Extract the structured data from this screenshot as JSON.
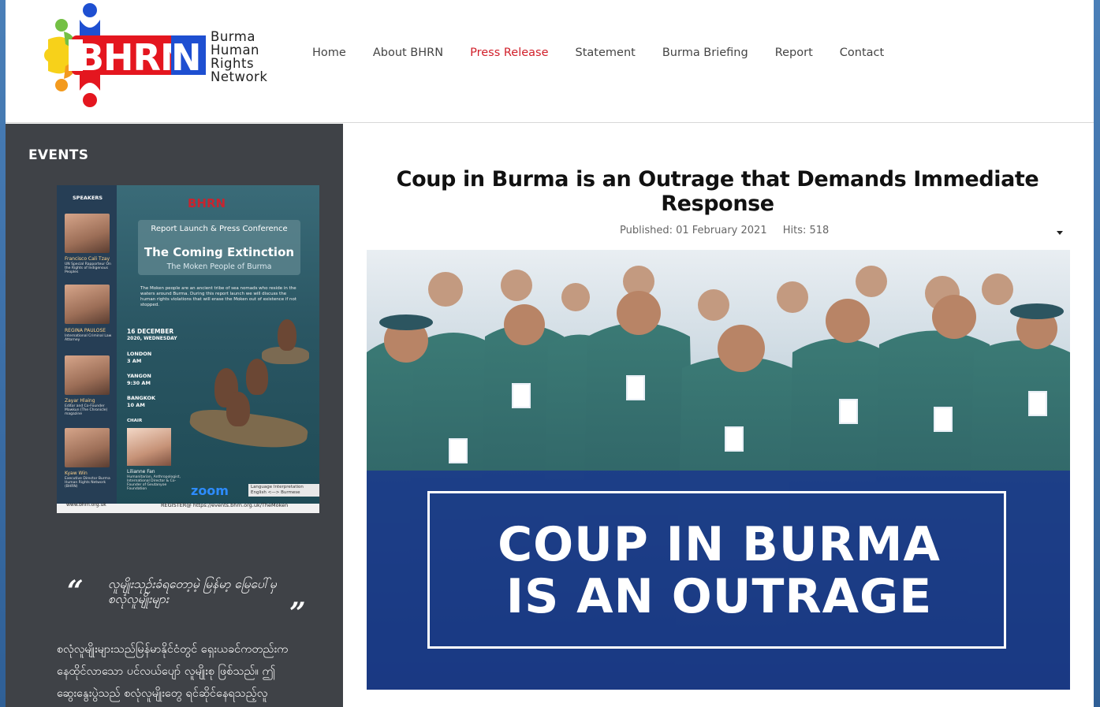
{
  "site": {
    "logo_letters": "BHRN",
    "logo_lines": [
      "Burma",
      "Human",
      "Rights",
      "Network"
    ]
  },
  "nav": {
    "items": [
      {
        "label": "Home",
        "active": false
      },
      {
        "label": "About BHRN",
        "active": false
      },
      {
        "label": "Press Release",
        "active": true
      },
      {
        "label": "Statement",
        "active": false
      },
      {
        "label": "Burma Briefing",
        "active": false
      },
      {
        "label": "Report",
        "active": false
      },
      {
        "label": "Contact",
        "active": false
      }
    ],
    "active_color": "#d11f2a"
  },
  "sidebar": {
    "title": "EVENTS",
    "poster": {
      "speakers_label": "SPEAKERS",
      "logo": "BHRN",
      "report_line": "Report Launch & Press Conference",
      "headline": "The Coming Extinction",
      "subheadline": "The Moken People of Burma",
      "description": "The Moken people are an ancient tribe of sea nomads who reside in the waters around Burma. During this report launch we will discuss the human rights violations that will erase the Moken out of existence if not stopped.",
      "date": "16 DECEMBER",
      "day": "2020, WEDNESDAY",
      "times": [
        {
          "city": "LONDON",
          "time": "3 AM"
        },
        {
          "city": "YANGON",
          "time": "9:30 AM"
        },
        {
          "city": "BANGKOK",
          "time": "10 AM"
        }
      ],
      "speakers": [
        {
          "name": "Francisco Cali Tzay",
          "role": "UN Special Rapporteur On the Rights of Indigenous Peoples"
        },
        {
          "name": "REGINA PAULOSE",
          "role": "International Criminal Law Attorney"
        },
        {
          "name": "Zayar Hlaing",
          "role": "Editor and Co-Founder Mawkun (The Chronicle) magazine"
        },
        {
          "name": "Kyaw Win",
          "role": "Executive Director Burma Human Rights Network (BHRN)"
        }
      ],
      "chair_label": "CHAIR",
      "chair": {
        "name": "Lilianne Fan",
        "role": "Humanitarian, Anthropologist, International Director & Co-Founder of Geutanyoe Foundation"
      },
      "platform": "zoom",
      "language_note": "Language Interpretation English <—> Burmese",
      "register": "REGISTER@  https://events.bhrn.org.uk/TheMoken",
      "website": "www.bhrn.org.uk"
    },
    "quote": "လူမျိုးသုဉ်းခံရတော့မဲ့ မြန်မာ့ မြေပေါ်မှစလုံလူမျိုးများ",
    "body": "စလုံလူမျိုးများသည်မြန်မာနိုင်ငံတွင် ရှေးယခင်ကတည်းက နေထိုင်လာသော ပင်လယ်ပျော် လူမျိုးစု ဖြစ်သည်။ ဤ ဆွေးနွေးပွဲသည် စလုံလူမျိုးတွေ ရင်ဆိုင်နေရသည့်လူ"
  },
  "article": {
    "title": "Coup in Burma is an Outrage that Demands Immediate Response",
    "published": "Published: 01 February 2021",
    "hits": "Hits: 518",
    "hero_lines": [
      "COUP IN BURMA",
      "IS AN OUTRAGE"
    ]
  }
}
